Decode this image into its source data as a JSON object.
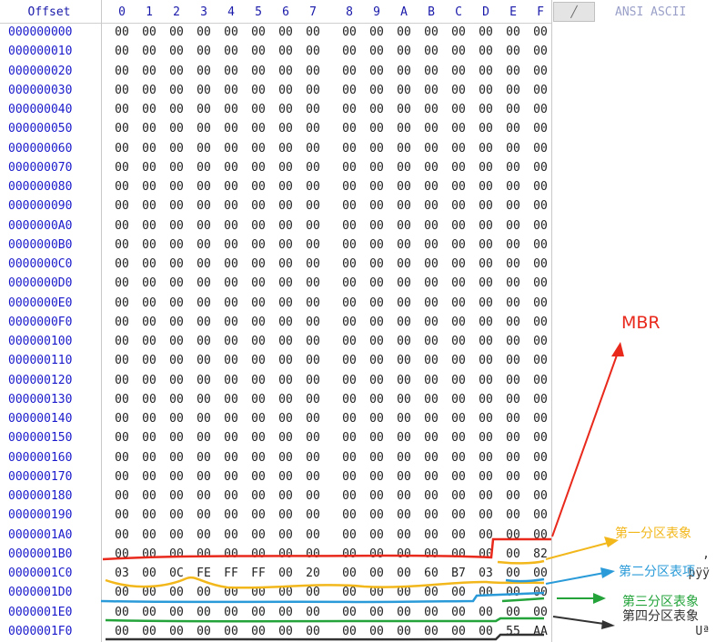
{
  "header": {
    "offset_label": "Offset",
    "columns": [
      "0",
      "1",
      "2",
      "3",
      "4",
      "5",
      "6",
      "7",
      "8",
      "9",
      "A",
      "B",
      "C",
      "D",
      "E",
      "F"
    ],
    "button_label": "╱",
    "ascii_label": "ANSI ASCII"
  },
  "rows": [
    {
      "offset": "000000000",
      "bytes": [
        "00",
        "00",
        "00",
        "00",
        "00",
        "00",
        "00",
        "00",
        "00",
        "00",
        "00",
        "00",
        "00",
        "00",
        "00",
        "00"
      ]
    },
    {
      "offset": "000000010",
      "bytes": [
        "00",
        "00",
        "00",
        "00",
        "00",
        "00",
        "00",
        "00",
        "00",
        "00",
        "00",
        "00",
        "00",
        "00",
        "00",
        "00"
      ]
    },
    {
      "offset": "000000020",
      "bytes": [
        "00",
        "00",
        "00",
        "00",
        "00",
        "00",
        "00",
        "00",
        "00",
        "00",
        "00",
        "00",
        "00",
        "00",
        "00",
        "00"
      ]
    },
    {
      "offset": "000000030",
      "bytes": [
        "00",
        "00",
        "00",
        "00",
        "00",
        "00",
        "00",
        "00",
        "00",
        "00",
        "00",
        "00",
        "00",
        "00",
        "00",
        "00"
      ]
    },
    {
      "offset": "000000040",
      "bytes": [
        "00",
        "00",
        "00",
        "00",
        "00",
        "00",
        "00",
        "00",
        "00",
        "00",
        "00",
        "00",
        "00",
        "00",
        "00",
        "00"
      ]
    },
    {
      "offset": "000000050",
      "bytes": [
        "00",
        "00",
        "00",
        "00",
        "00",
        "00",
        "00",
        "00",
        "00",
        "00",
        "00",
        "00",
        "00",
        "00",
        "00",
        "00"
      ]
    },
    {
      "offset": "000000060",
      "bytes": [
        "00",
        "00",
        "00",
        "00",
        "00",
        "00",
        "00",
        "00",
        "00",
        "00",
        "00",
        "00",
        "00",
        "00",
        "00",
        "00"
      ]
    },
    {
      "offset": "000000070",
      "bytes": [
        "00",
        "00",
        "00",
        "00",
        "00",
        "00",
        "00",
        "00",
        "00",
        "00",
        "00",
        "00",
        "00",
        "00",
        "00",
        "00"
      ]
    },
    {
      "offset": "000000080",
      "bytes": [
        "00",
        "00",
        "00",
        "00",
        "00",
        "00",
        "00",
        "00",
        "00",
        "00",
        "00",
        "00",
        "00",
        "00",
        "00",
        "00"
      ]
    },
    {
      "offset": "000000090",
      "bytes": [
        "00",
        "00",
        "00",
        "00",
        "00",
        "00",
        "00",
        "00",
        "00",
        "00",
        "00",
        "00",
        "00",
        "00",
        "00",
        "00"
      ]
    },
    {
      "offset": "0000000A0",
      "bytes": [
        "00",
        "00",
        "00",
        "00",
        "00",
        "00",
        "00",
        "00",
        "00",
        "00",
        "00",
        "00",
        "00",
        "00",
        "00",
        "00"
      ]
    },
    {
      "offset": "0000000B0",
      "bytes": [
        "00",
        "00",
        "00",
        "00",
        "00",
        "00",
        "00",
        "00",
        "00",
        "00",
        "00",
        "00",
        "00",
        "00",
        "00",
        "00"
      ]
    },
    {
      "offset": "0000000C0",
      "bytes": [
        "00",
        "00",
        "00",
        "00",
        "00",
        "00",
        "00",
        "00",
        "00",
        "00",
        "00",
        "00",
        "00",
        "00",
        "00",
        "00"
      ]
    },
    {
      "offset": "0000000D0",
      "bytes": [
        "00",
        "00",
        "00",
        "00",
        "00",
        "00",
        "00",
        "00",
        "00",
        "00",
        "00",
        "00",
        "00",
        "00",
        "00",
        "00"
      ]
    },
    {
      "offset": "0000000E0",
      "bytes": [
        "00",
        "00",
        "00",
        "00",
        "00",
        "00",
        "00",
        "00",
        "00",
        "00",
        "00",
        "00",
        "00",
        "00",
        "00",
        "00"
      ]
    },
    {
      "offset": "0000000F0",
      "bytes": [
        "00",
        "00",
        "00",
        "00",
        "00",
        "00",
        "00",
        "00",
        "00",
        "00",
        "00",
        "00",
        "00",
        "00",
        "00",
        "00"
      ]
    },
    {
      "offset": "000000100",
      "bytes": [
        "00",
        "00",
        "00",
        "00",
        "00",
        "00",
        "00",
        "00",
        "00",
        "00",
        "00",
        "00",
        "00",
        "00",
        "00",
        "00"
      ]
    },
    {
      "offset": "000000110",
      "bytes": [
        "00",
        "00",
        "00",
        "00",
        "00",
        "00",
        "00",
        "00",
        "00",
        "00",
        "00",
        "00",
        "00",
        "00",
        "00",
        "00"
      ]
    },
    {
      "offset": "000000120",
      "bytes": [
        "00",
        "00",
        "00",
        "00",
        "00",
        "00",
        "00",
        "00",
        "00",
        "00",
        "00",
        "00",
        "00",
        "00",
        "00",
        "00"
      ]
    },
    {
      "offset": "000000130",
      "bytes": [
        "00",
        "00",
        "00",
        "00",
        "00",
        "00",
        "00",
        "00",
        "00",
        "00",
        "00",
        "00",
        "00",
        "00",
        "00",
        "00"
      ]
    },
    {
      "offset": "000000140",
      "bytes": [
        "00",
        "00",
        "00",
        "00",
        "00",
        "00",
        "00",
        "00",
        "00",
        "00",
        "00",
        "00",
        "00",
        "00",
        "00",
        "00"
      ]
    },
    {
      "offset": "000000150",
      "bytes": [
        "00",
        "00",
        "00",
        "00",
        "00",
        "00",
        "00",
        "00",
        "00",
        "00",
        "00",
        "00",
        "00",
        "00",
        "00",
        "00"
      ]
    },
    {
      "offset": "000000160",
      "bytes": [
        "00",
        "00",
        "00",
        "00",
        "00",
        "00",
        "00",
        "00",
        "00",
        "00",
        "00",
        "00",
        "00",
        "00",
        "00",
        "00"
      ]
    },
    {
      "offset": "000000170",
      "bytes": [
        "00",
        "00",
        "00",
        "00",
        "00",
        "00",
        "00",
        "00",
        "00",
        "00",
        "00",
        "00",
        "00",
        "00",
        "00",
        "00"
      ]
    },
    {
      "offset": "000000180",
      "bytes": [
        "00",
        "00",
        "00",
        "00",
        "00",
        "00",
        "00",
        "00",
        "00",
        "00",
        "00",
        "00",
        "00",
        "00",
        "00",
        "00"
      ]
    },
    {
      "offset": "000000190",
      "bytes": [
        "00",
        "00",
        "00",
        "00",
        "00",
        "00",
        "00",
        "00",
        "00",
        "00",
        "00",
        "00",
        "00",
        "00",
        "00",
        "00"
      ]
    },
    {
      "offset": "0000001A0",
      "bytes": [
        "00",
        "00",
        "00",
        "00",
        "00",
        "00",
        "00",
        "00",
        "00",
        "00",
        "00",
        "00",
        "00",
        "00",
        "00",
        "00"
      ]
    },
    {
      "offset": "0000001B0",
      "bytes": [
        "00",
        "00",
        "00",
        "00",
        "00",
        "00",
        "00",
        "00",
        "00",
        "00",
        "00",
        "00",
        "00",
        "00",
        "00",
        "82"
      ],
      "ascii": "‚"
    },
    {
      "offset": "0000001C0",
      "bytes": [
        "03",
        "00",
        "0C",
        "FE",
        "FF",
        "FF",
        "00",
        "20",
        "00",
        "00",
        "00",
        "60",
        "B7",
        "03",
        "00",
        "00"
      ],
      "ascii": "þÿÿ"
    },
    {
      "offset": "0000001D0",
      "bytes": [
        "00",
        "00",
        "00",
        "00",
        "00",
        "00",
        "00",
        "00",
        "00",
        "00",
        "00",
        "00",
        "00",
        "00",
        "00",
        "00"
      ]
    },
    {
      "offset": "0000001E0",
      "bytes": [
        "00",
        "00",
        "00",
        "00",
        "00",
        "00",
        "00",
        "00",
        "00",
        "00",
        "00",
        "00",
        "00",
        "00",
        "00",
        "00"
      ]
    },
    {
      "offset": "0000001F0",
      "bytes": [
        "00",
        "00",
        "00",
        "00",
        "00",
        "00",
        "00",
        "00",
        "00",
        "00",
        "00",
        "00",
        "00",
        "00",
        "55",
        "AA"
      ],
      "ascii": "Uª"
    }
  ],
  "annotations": {
    "mbr": {
      "label": "MBR",
      "color": "#e8291c"
    },
    "partition1": {
      "label": "第一分区表象",
      "color": "#f2b71b"
    },
    "partition2": {
      "label": "第二分区表项",
      "color": "#2a9bd8"
    },
    "partition3": {
      "label": "第三分区表象",
      "color": "#23a33a"
    },
    "partition4": {
      "label": "第四分区表象",
      "color": "#333333"
    }
  }
}
